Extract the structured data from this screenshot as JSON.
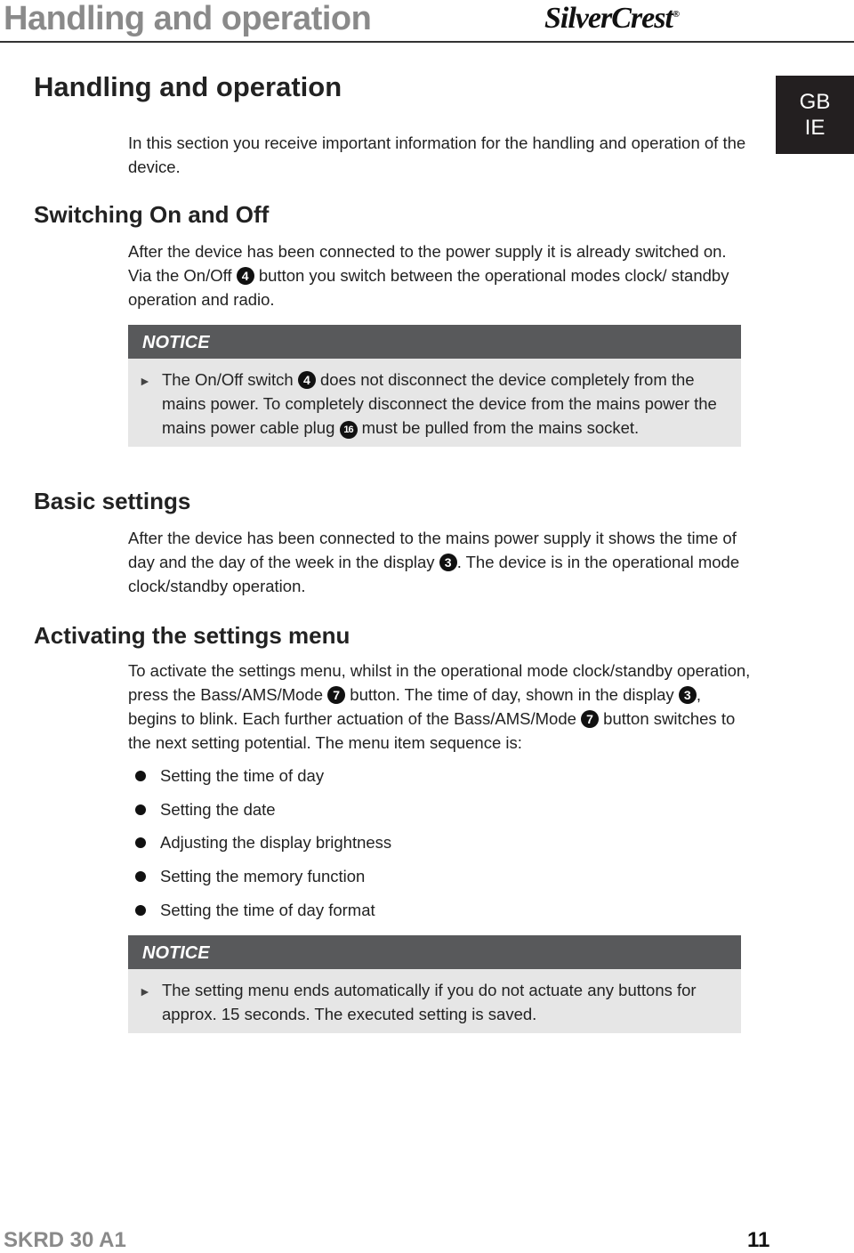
{
  "header": {
    "title": "Handling and operation",
    "brand": "SilverCrest",
    "registered_mark": "®"
  },
  "language_badge": {
    "line1": "GB",
    "line2": "IE"
  },
  "section_main": {
    "title": "Handling and operation",
    "intro": "In this section you receive important information for the handling and operation of the device."
  },
  "switching": {
    "title": "Switching On and Off",
    "text_a": "After the device has been connected to the power supply it is already switched on. Via the On/Off ",
    "ref": "4",
    "text_b": " button you switch between the operational modes clock/ standby operation and radio.",
    "notice": {
      "label": "NOTICE",
      "text_a": "The On/Off switch ",
      "ref1": "4",
      "text_b": " does not disconnect the device completely from the mains power. To completely disconnect the device from the mains power the mains power cable plug ",
      "ref2": "16",
      "text_c": " must be pulled from the mains socket."
    }
  },
  "basic": {
    "title": "Basic settings",
    "text_a": "After the device has been connected to the mains power supply it shows the time of day and the day of the week in the display ",
    "ref": "3",
    "text_b": ". The device is in the operational mode clock/standby operation."
  },
  "activating": {
    "title": "Activating the settings menu",
    "text_a": "To activate the settings menu, whilst in the operational mode clock/standby operation, press the Bass/AMS/Mode ",
    "ref1": "7",
    "text_b": " button. The time of day, shown in the display ",
    "ref2": "3",
    "text_c": ", begins to blink. Each further actuation of the Bass/AMS/Mode ",
    "ref3": "7",
    "text_d": " button switches to the next setting potential. The menu item sequence is:",
    "items": [
      "Setting the time of day",
      "Setting the date",
      "Adjusting the display brightness",
      "Setting the memory function",
      "Setting the time of day format"
    ],
    "notice": {
      "label": "NOTICE",
      "text": "The setting menu ends automatically if you do not actuate any buttons for approx. 15 seconds. The executed setting is saved."
    }
  },
  "footer": {
    "model": "SKRD 30 A1",
    "page": "11"
  }
}
